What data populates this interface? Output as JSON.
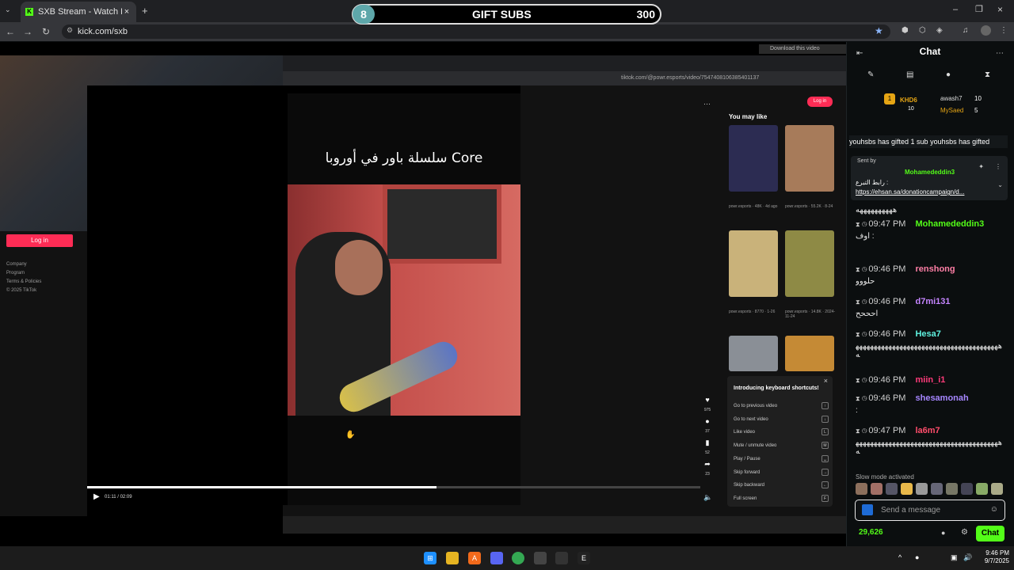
{
  "browser": {
    "tab_title": "SXB Stream - Watch Live on Kick",
    "url": "kick.com/sxb"
  },
  "overlay": {
    "gift_count_badge": "8",
    "gift_label": "GIFT SUBS",
    "gift_goal": "300"
  },
  "captured": {
    "inner_url": "tiktok.com/@powr.esports/video/7547408106385401137",
    "download_label": "Download this video",
    "login_label": "Log in",
    "left_links": [
      "Company",
      "Program",
      "Terms & Policies",
      "© 2025 TikTok"
    ],
    "video_caption": "سلسلة باور في أوروبا Core",
    "time": "01:11 / 02:09",
    "progress_fraction": 0.57,
    "you_may_like": "You may like",
    "thumbs": [
      {
        "cap": "powr.esports · 48K · 4d ago",
        "color": "#2c2c52"
      },
      {
        "cap": "powr.esports · 55.2K · 8-24",
        "color": "#a77b5a"
      },
      {
        "cap": "powr.esports · 8770 · 1-26",
        "color": "#c9b27a"
      },
      {
        "cap": "powr.esports · 14.8K · 2024-11-24",
        "color": "#8e8a45"
      },
      {
        "cap": "",
        "color": "#8a8f96"
      },
      {
        "cap": "",
        "color": "#c58a35"
      }
    ],
    "side_counts": [
      "975",
      "37",
      "52",
      "23"
    ],
    "shortcuts_title": "Introducing keyboard shortcuts!",
    "shortcuts": [
      {
        "label": "Go to previous video",
        "key": "↑"
      },
      {
        "label": "Go to next video",
        "key": "↓"
      },
      {
        "label": "Like video",
        "key": "L"
      },
      {
        "label": "Mute / unmute video",
        "key": "M"
      },
      {
        "label": "Play / Pause",
        "key": "␣"
      },
      {
        "label": "Skip forward",
        "key": "→"
      },
      {
        "label": "Skip backward",
        "key": "←"
      },
      {
        "label": "Full screen",
        "key": "F"
      }
    ]
  },
  "chat": {
    "title": "Chat",
    "leaderboard": [
      {
        "name": "KHD6",
        "count": "10"
      },
      {
        "name": "awash7",
        "count": "10"
      },
      {
        "name": "MySaed",
        "count": "5"
      }
    ],
    "gift_ticker": "youhsbs has gifted 1 sub  youhsbs has gifted",
    "pinned": {
      "sent_by": "Sent by",
      "user": "Mohamededdin3",
      "text": "رابط التبرع :",
      "link": "https://ehsan.sa/donationcampaign/d..."
    },
    "messages": [
      {
        "time": "",
        "user": "",
        "color": "#e8e8e8",
        "text": "ههههههههههه"
      },
      {
        "time": "09:47 PM",
        "user": "Mohamededdin3",
        "color": "#53fc18",
        "text": "اوف :"
      },
      {
        "time": "09:46 PM",
        "user": "renshong",
        "color": "#ff7fa6",
        "text": "حلووو"
      },
      {
        "time": "09:46 PM",
        "user": "d7mi131",
        "color": "#c585ff",
        "text": "احححح"
      },
      {
        "time": "09:46 PM",
        "user": "Hesa7",
        "color": "#5ff2e0",
        "text": "ههههههههههههههههههههههههههههههههههههههههه"
      },
      {
        "time": "09:46 PM",
        "user": "miin_i1",
        "color": "#ff3b7a",
        "text": ""
      },
      {
        "time": "09:46 PM",
        "user": "shesamonah",
        "color": "#a686ff",
        "text": ":"
      },
      {
        "time": "09:47 PM",
        "user": "la6m7",
        "color": "#ff4d6b",
        "text": "ههههههههههههههههههههههههههههههههههههههههه"
      }
    ],
    "slow_mode": "Slow mode activated",
    "input_placeholder": "Send a message",
    "points": "29,626",
    "send_label": "Chat"
  },
  "taskbar": {
    "time": "9:46 PM",
    "date": "9/7/2025"
  }
}
